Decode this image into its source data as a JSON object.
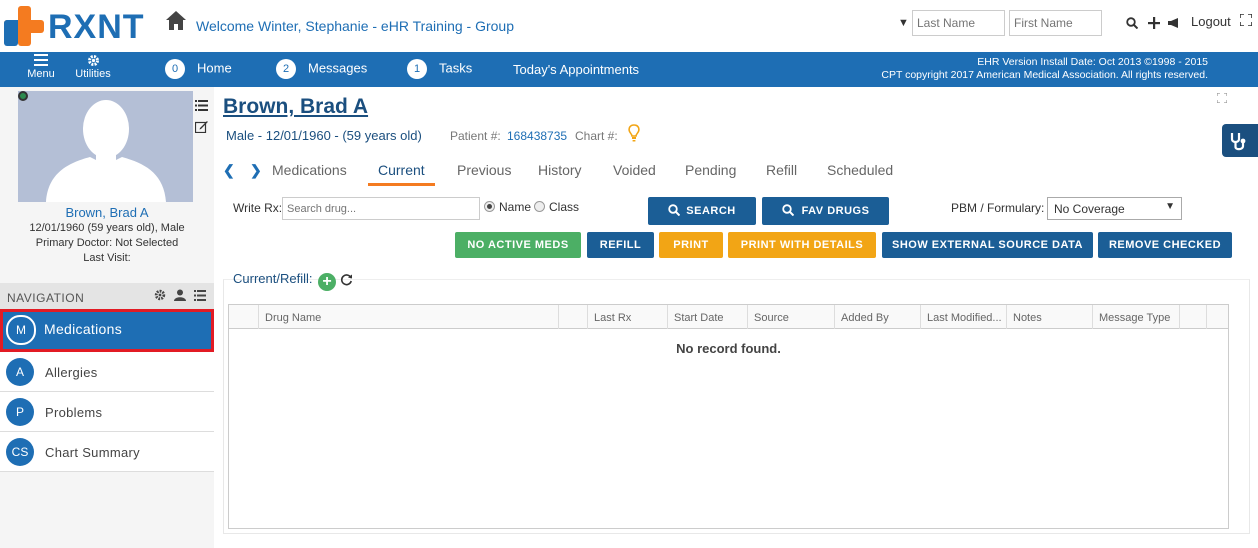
{
  "header": {
    "logo_text": "RXNT",
    "welcome": "Welcome  Winter, Stephanie - eHR Training - Group",
    "last_name_placeholder": "Last Name",
    "first_name_placeholder": "First Name",
    "logout_label": "Logout"
  },
  "navbar": {
    "menu_label": "Menu",
    "utilities_label": "Utilities",
    "home_count": "0",
    "home_label": "Home",
    "messages_count": "2",
    "messages_label": "Messages",
    "tasks_count": "1",
    "tasks_label": "Tasks",
    "appointments_label": "Today's Appointments",
    "version_line": "EHR Version Install Date: Oct 2013 ©1998 - 2015",
    "copyright_line": "CPT copyright 2017 American Medical Association. All rights reserved."
  },
  "patient_card": {
    "name": "Brown, Brad A",
    "dob_line": "12/01/1960 (59 years old), Male",
    "primary_doctor": "Primary Doctor: Not Selected",
    "last_visit": "Last Visit:"
  },
  "navigation": {
    "heading": "NAVIGATION",
    "items": [
      {
        "abbr": "M",
        "label": "Medications"
      },
      {
        "abbr": "A",
        "label": "Allergies"
      },
      {
        "abbr": "P",
        "label": "Problems"
      },
      {
        "abbr": "CS",
        "label": "Chart Summary"
      }
    ]
  },
  "patient": {
    "title": "Brown, Brad A",
    "subtitle": "Male - 12/01/1960 - (59 years old)",
    "patient_num_label": "Patient #:",
    "patient_num": "168438735",
    "chart_num_label": "Chart #:"
  },
  "tabs": {
    "section": "Medications",
    "items": [
      "Current",
      "Previous",
      "History",
      "Voided",
      "Pending",
      "Refill",
      "Scheduled"
    ],
    "active": "Current"
  },
  "write_rx": {
    "label": "Write Rx:",
    "placeholder": "Search drug...",
    "radio_name": "Name",
    "radio_class": "Class",
    "selected": "Name"
  },
  "buttons": {
    "search": "SEARCH",
    "fav_drugs": "FAV DRUGS",
    "no_active_meds": "NO ACTIVE MEDS",
    "refill": "REFILL",
    "print": "PRINT",
    "print_details": "PRINT WITH DETAILS",
    "show_external": "SHOW EXTERNAL SOURCE DATA",
    "remove_checked": "REMOVE CHECKED"
  },
  "pbm": {
    "label": "PBM / Formulary:",
    "value": "No Coverage"
  },
  "current_refill": {
    "label": "Current/Refill:"
  },
  "grid": {
    "columns": [
      "Drug Name",
      "",
      "Last Rx",
      "Start Date",
      "Source",
      "Added By",
      "Last Modified...",
      "Notes",
      "Message Type"
    ],
    "empty_message": "No record found."
  },
  "colors": {
    "brand_blue": "#1e6eb4",
    "brand_orange": "#f47b20",
    "button_blue": "#1b5e96",
    "button_green": "#4caf65",
    "button_orange": "#f2a515",
    "highlight_red": "#e21b24"
  }
}
